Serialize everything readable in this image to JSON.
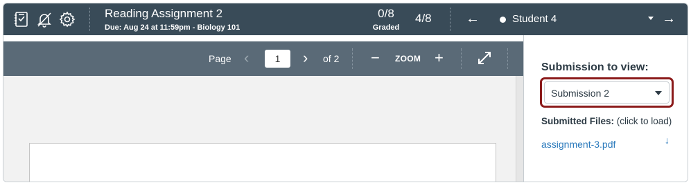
{
  "header": {
    "icons": [
      "gradebook-icon",
      "notification-off-icon",
      "settings-icon"
    ],
    "title": "Reading Assignment 2",
    "subtitle": "Due: Aug 24 at 11:59pm - Biology 101",
    "graded_count": "0/8",
    "graded_label": "Graded",
    "progress": "4/8",
    "prev_arrow": "←",
    "next_arrow": "→",
    "student": "Student 4"
  },
  "viewer": {
    "page_label": "Page",
    "prev_page": "‹",
    "page_number": "1",
    "next_page": "›",
    "of_pages": "of 2",
    "zoom_out": "−",
    "zoom_label": "ZOOM",
    "zoom_in": "+",
    "fullscreen_icon": "expand-icon"
  },
  "panel": {
    "heading": "Submission to view:",
    "selected_submission": "Submission 2",
    "files_label_bold": "Submitted Files:",
    "files_label_rest": " (click to load)",
    "file_name": "assignment-3.pdf",
    "download_glyph": "↓"
  },
  "colors": {
    "topbar": "#394b58",
    "viewer_toolbar": "#5a6a77",
    "focus_ring": "#8b1a1a",
    "link": "#2b7abc"
  }
}
